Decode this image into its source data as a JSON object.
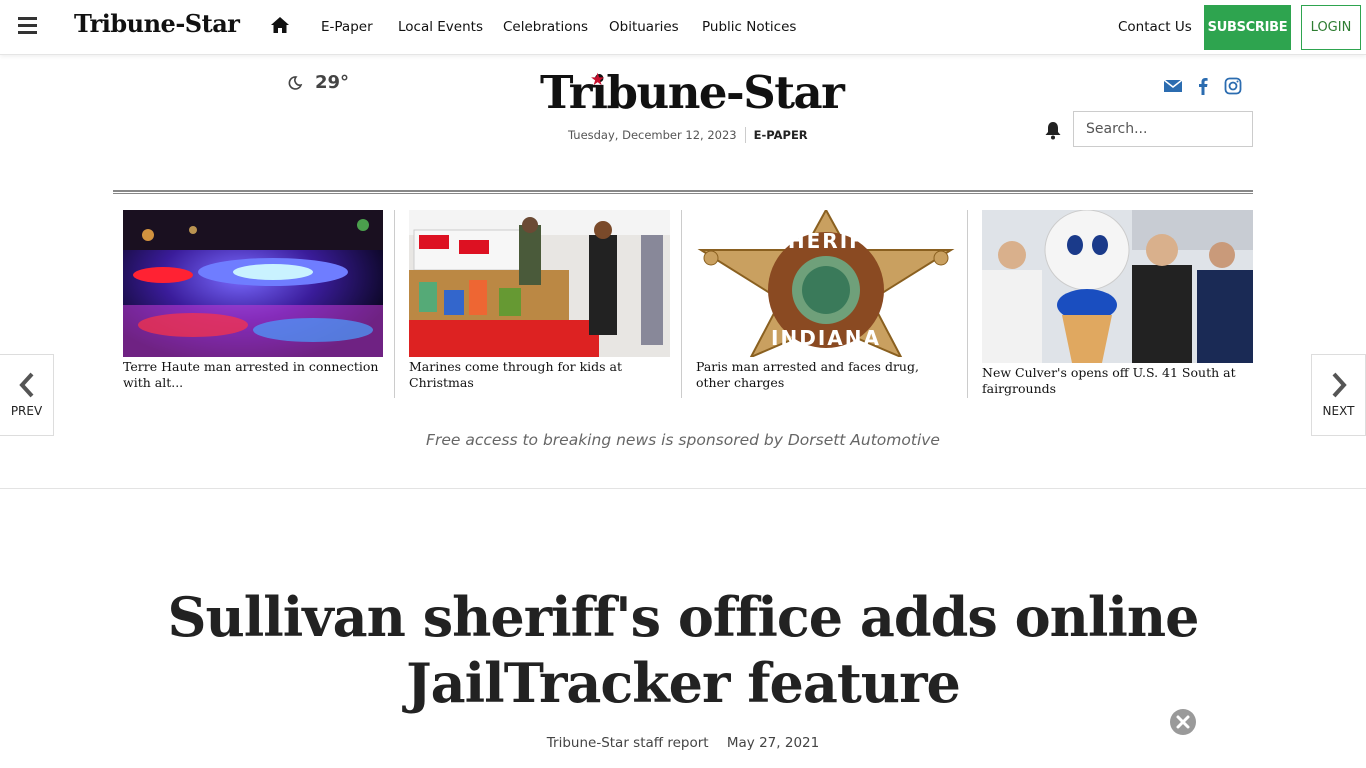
{
  "topnav": {
    "logo": "Tribune-Star",
    "links": [
      "E-Paper",
      "Local Events",
      "Celebrations",
      "Obituaries",
      "Public Notices"
    ],
    "contact": "Contact Us",
    "subscribe": "SUBSCRIBE",
    "login": "LOGIN"
  },
  "masthead": {
    "weather_temp": "29°",
    "logo": "Tribune-Star",
    "date": "Tuesday, December 12, 2023",
    "epaper": "E-PAPER",
    "search_placeholder": "Search..."
  },
  "carousel": {
    "prev": "PREV",
    "next": "NEXT",
    "items": [
      {
        "title": "Terre Haute man arrested in connection with alt..."
      },
      {
        "title": "Marines come through for kids at Christmas"
      },
      {
        "title": "Paris man arrested and faces drug, other charges"
      },
      {
        "title": "New Culver's opens off U.S. 41 South at fairgrounds"
      }
    ],
    "sponsor": "Free access to breaking news is sponsored by Dorsett Automotive"
  },
  "article": {
    "headline": "Sullivan sheriff's office adds online JailTracker feature",
    "author": "Tribune-Star staff report",
    "date": "May 27, 2021"
  },
  "colors": {
    "accent_green": "#2ea44f",
    "logo_star_red": "#c8102e",
    "social_blue": "#2b6cb0"
  }
}
